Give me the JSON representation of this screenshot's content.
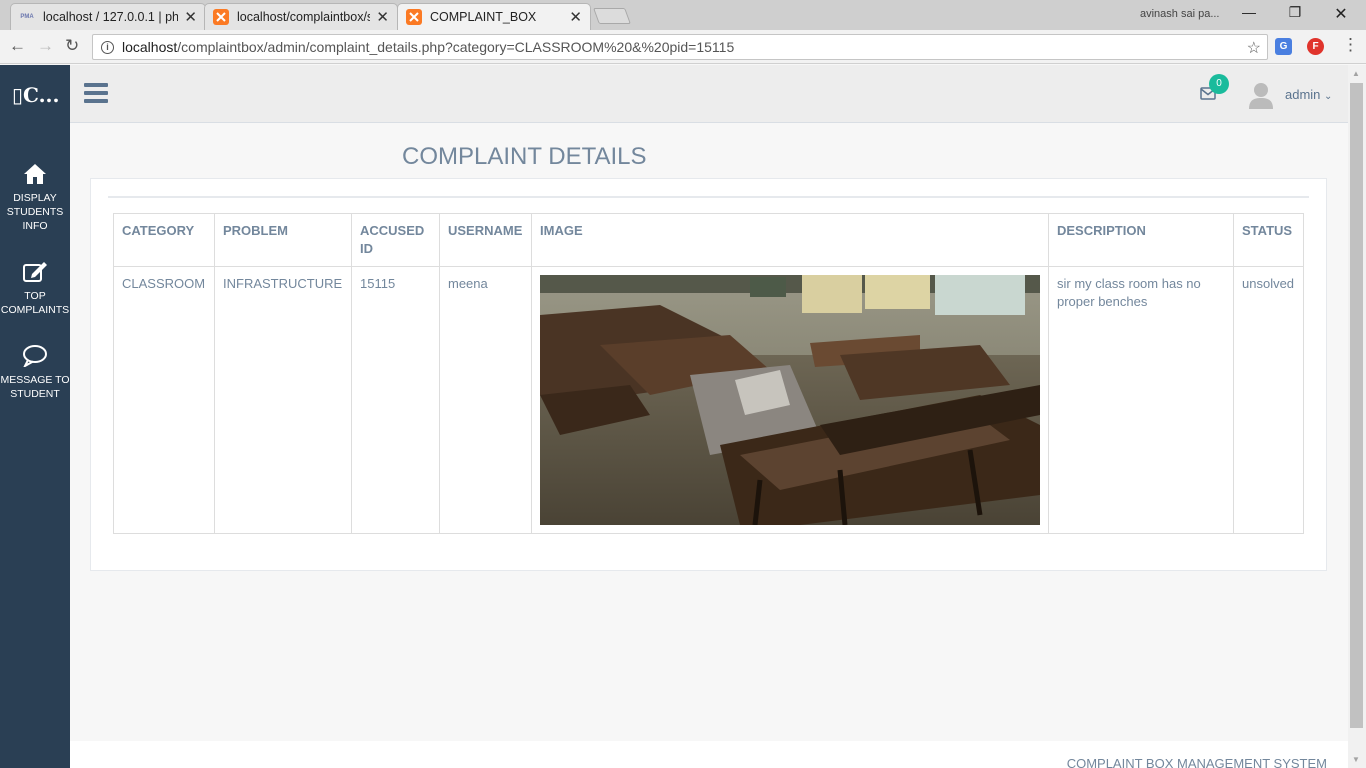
{
  "browser": {
    "tabs": [
      {
        "title": "localhost / 127.0.0.1 | php",
        "favicon": "pma"
      },
      {
        "title": "localhost/complaintbox/s",
        "favicon": "xampp"
      },
      {
        "title": "COMPLAINT_BOX",
        "favicon": "xampp",
        "active": true
      }
    ],
    "profile_name": "avinash sai pa...",
    "url_host": "localhost",
    "url_path": "/complaintbox/admin/complaint_details.php?category=CLASSROOM%20&%20pid=15115"
  },
  "app": {
    "brand": "▯C...",
    "sidebar": [
      {
        "label": "DISPLAY STUDENTS INFO",
        "icon": "home-icon"
      },
      {
        "label": "TOP COMPLAINTS",
        "icon": "edit-icon"
      },
      {
        "label": "MESSAGE TO STUDENT",
        "icon": "chat-icon"
      }
    ],
    "header": {
      "mail_count": "0",
      "user": "admin"
    },
    "page_title": "COMPLAINT DETAILS",
    "table": {
      "headers": [
        "CATEGORY",
        "PROBLEM",
        "ACCUSED ID",
        "USERNAME",
        "IMAGE",
        "DESCRIPTION",
        "STATUS"
      ],
      "rows": [
        {
          "category": "CLASSROOM",
          "problem": "INFRASTRUCTURE",
          "accused_id": "15115",
          "username": "meena",
          "image": "classroom-broken-benches-photo",
          "description": "sir my class room has no proper benches",
          "status": "unsolved"
        }
      ]
    },
    "footer": "COMPLAINT BOX MANAGEMENT SYSTEM"
  },
  "colors": {
    "sidebar": "#2a3f54",
    "accent_text": "#73879c",
    "badge": "#1abb9c"
  }
}
